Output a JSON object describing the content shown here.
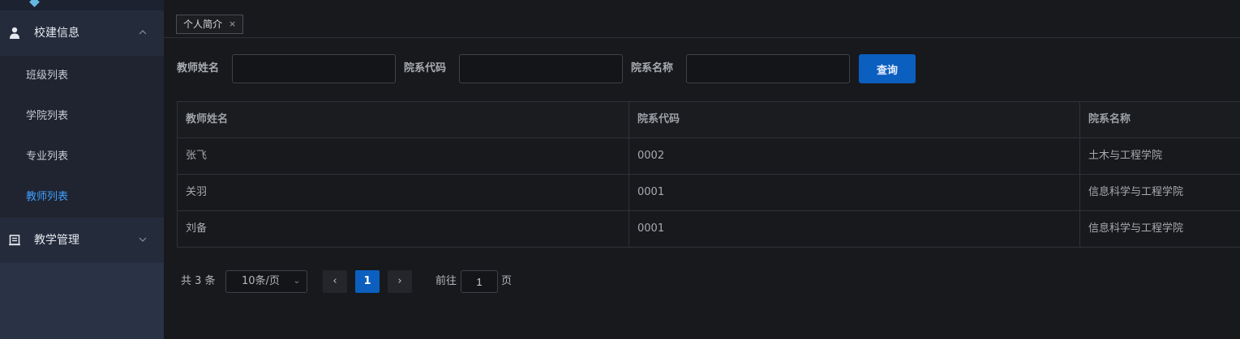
{
  "sidebar": {
    "groups": [
      {
        "title": "校建信息",
        "icon": "user-icon",
        "expanded": true,
        "items": [
          {
            "label": "班级列表"
          },
          {
            "label": "学院列表"
          },
          {
            "label": "专业列表"
          },
          {
            "label": "教师列表",
            "active": true
          }
        ]
      },
      {
        "title": "教学管理",
        "icon": "document-icon",
        "expanded": false
      }
    ]
  },
  "tabs": [
    {
      "label": "个人简介",
      "close": "×"
    }
  ],
  "filters": {
    "teacher_name_label": "教师姓名",
    "dept_code_label": "院系代码",
    "dept_name_label": "院系名称",
    "teacher_name_value": "",
    "dept_code_value": "",
    "dept_name_value": "",
    "query_button": "查询"
  },
  "table": {
    "headers": [
      "教师姓名",
      "院系代码",
      "院系名称"
    ],
    "rows": [
      [
        "张飞",
        "0002",
        "土木与工程学院"
      ],
      [
        "关羽",
        "0001",
        "信息科学与工程学院"
      ],
      [
        "刘备",
        "0001",
        "信息科学与工程学院"
      ]
    ]
  },
  "pagination": {
    "total": "共 3 条",
    "page_size": "10条/页",
    "prev": "‹",
    "current": "1",
    "next": "›",
    "goto_label": "前往",
    "goto_value": "1",
    "page_suffix": "页"
  },
  "colors": {
    "accent": "#0b5fbf",
    "active_link": "#409eff"
  }
}
